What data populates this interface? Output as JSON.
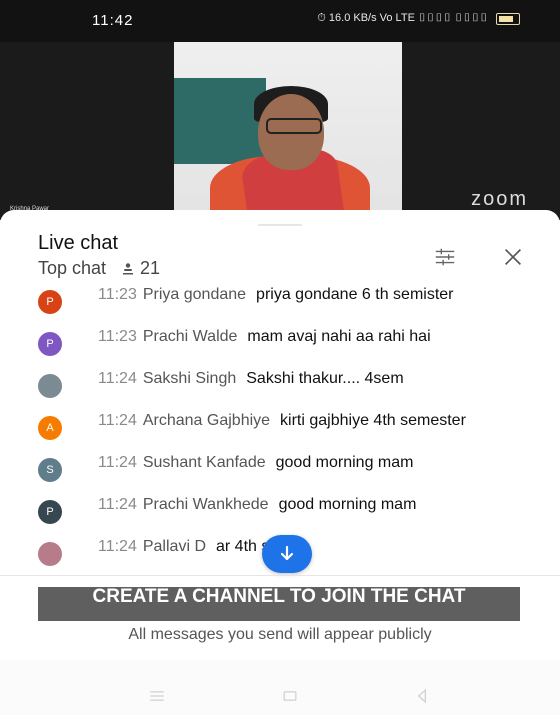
{
  "status": {
    "time": "11:42",
    "icons_text": "⏱ 16.0 KB/s Vo LTE ▯▯▯▯ ▯▯▯▯"
  },
  "video": {
    "participant_name": "Krishna Pawar",
    "zoom_brand": "zoom"
  },
  "chat": {
    "title": "Live chat",
    "mode": "Top chat",
    "viewers": "21",
    "icons": [
      "filter-icon",
      "close-icon"
    ]
  },
  "messages": [
    {
      "initial": "P",
      "color": "#D84315",
      "time": "11:23",
      "author": "Priya gondane",
      "text": "priya gondane 6 th semister"
    },
    {
      "initial": "P",
      "color": "#7E57C2",
      "time": "11:23",
      "author": "Prachi Walde",
      "text": "mam avaj nahi aa rahi hai"
    },
    {
      "initial": "",
      "color": "#7c8a94",
      "time": "11:24",
      "author": "Sakshi Singh",
      "text": "Sakshi thakur.... 4sem"
    },
    {
      "initial": "A",
      "color": "#F57C00",
      "time": "11:24",
      "author": "Archana Gajbhiye",
      "text": "kirti gajbhiye 4th semester"
    },
    {
      "initial": "S",
      "color": "#607D8B",
      "time": "11:24",
      "author": "Sushant Kanfade",
      "text": "good morning mam"
    },
    {
      "initial": "P",
      "color": "#37474F",
      "time": "11:24",
      "author": "Prachi Wankhede",
      "text": "good morning mam"
    },
    {
      "initial": "",
      "color": "#b77b8a",
      "time": "11:24",
      "author": "Pallavi D",
      "text": "ar 4th sem"
    }
  ],
  "footer": {
    "create_channel": "CREATE A CHANNEL TO JOIN THE CHAT",
    "public_note": "All messages you send will appear publicly"
  },
  "colors": {
    "accent": "#1E73E8",
    "button": "#5F5F5F"
  }
}
